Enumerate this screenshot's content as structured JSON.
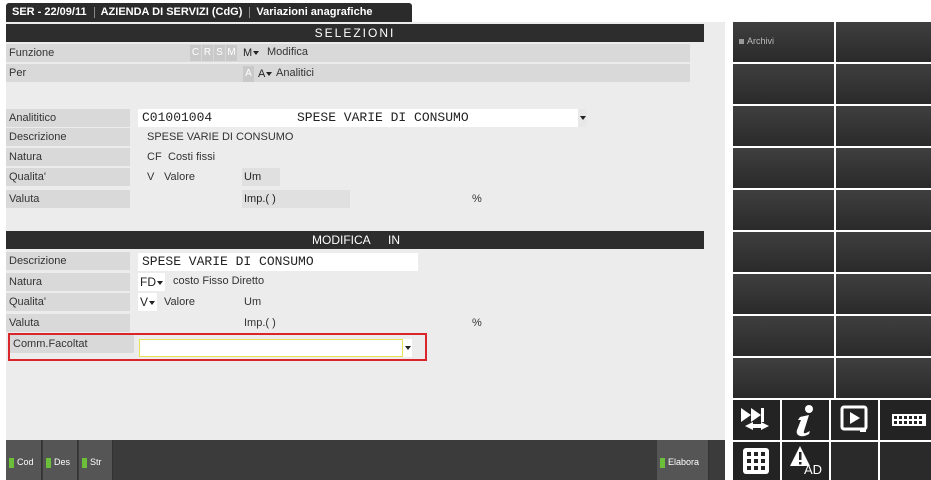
{
  "title": {
    "program": "SER - 22/09/11",
    "company": "AZIENDA DI SERVIZI (CdG)",
    "screen": "Variazioni anagrafiche"
  },
  "selezioni": {
    "header": "SELEZIONI",
    "funzione_label": "Funzione",
    "crsm": [
      "C",
      "R",
      "S",
      "M"
    ],
    "funzione_code": "M",
    "funzione_value": "Modifica",
    "per_label": "Per",
    "per_box": "A",
    "per_code": "A",
    "per_value": "Analitici",
    "analitico_label": "Analititico",
    "analitico_code": "C01001004",
    "analitico_desc": "SPESE VARIE DI CONSUMO",
    "descrizione_label": "Descrizione",
    "descrizione_value": "SPESE VARIE DI CONSUMO",
    "natura_label": "Natura",
    "natura_code": "CF",
    "natura_value": "Costi fissi",
    "qualita_label": "Qualita'",
    "qualita_code": "V",
    "qualita_value": "Valore",
    "um_label": "Um",
    "valuta_label": "Valuta",
    "imp_label": "Imp.(  )",
    "percent": "%"
  },
  "modifica": {
    "header_left": "MODIFICA",
    "header_right": "IN",
    "descrizione_label": "Descrizione",
    "descrizione_value": "SPESE VARIE DI CONSUMO",
    "natura_label": "Natura",
    "natura_code": "FD",
    "natura_value": "costo Fisso Diretto",
    "qualita_label": "Qualita'",
    "qualita_code": "V",
    "qualita_value": "Valore",
    "um_label": "Um",
    "valuta_label": "Valuta",
    "imp_label": "Imp.(  )",
    "percent": "%",
    "comm_label": "Comm.Facoltat",
    "comm_value": ""
  },
  "bottom": {
    "keys": [
      "Cod",
      "Des",
      "Str"
    ],
    "elabora": "Elabora"
  },
  "right": {
    "archivi": "Archivi",
    "ad_label": "AD"
  },
  "colors": {
    "accent_green": "#6bbf3a",
    "highlight_red": "#d9262a",
    "header_dark": "#2d2d2d"
  }
}
